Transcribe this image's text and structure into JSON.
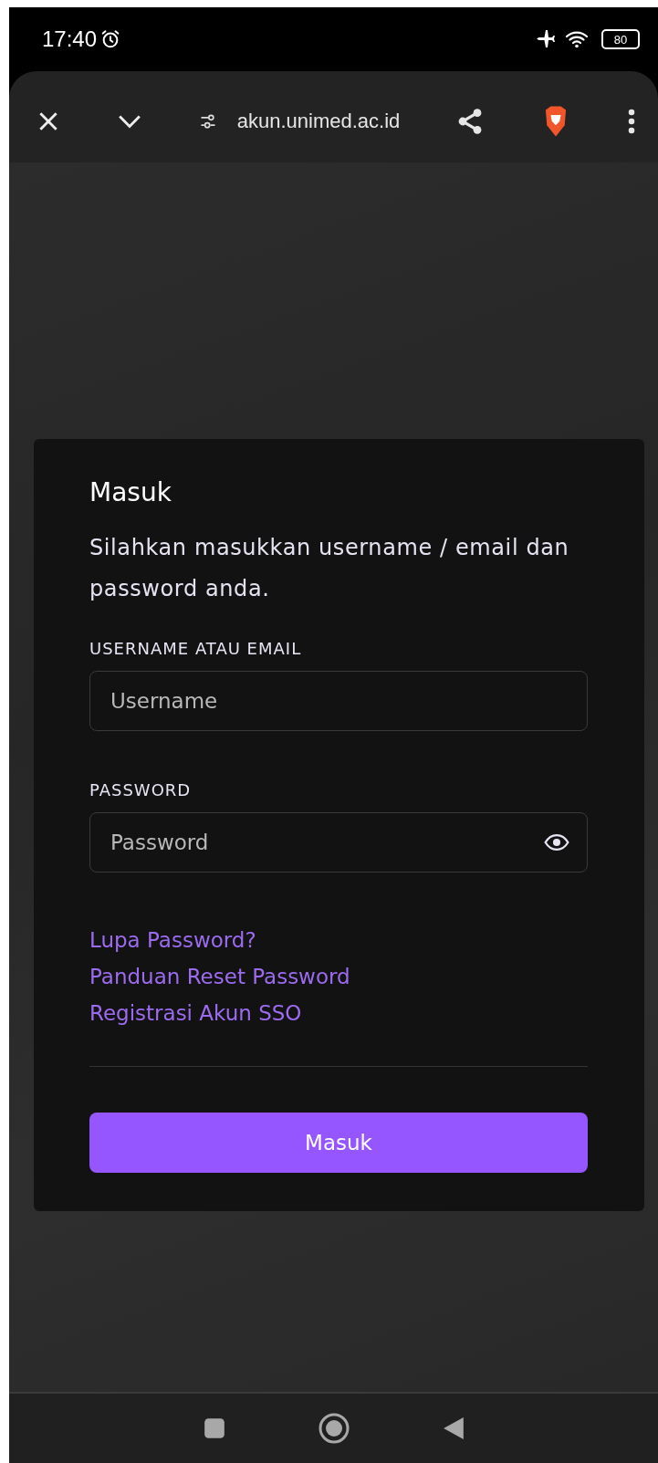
{
  "status_bar": {
    "time": "17:40",
    "battery": "80"
  },
  "browser_toolbar": {
    "url": "akun.unimed.ac.id"
  },
  "login_card": {
    "title": "Masuk",
    "description": "Silahkan masukkan username / email dan password anda.",
    "fields": [
      {
        "kind": "text",
        "label": "USERNAME ATAU EMAIL",
        "placeholder": "Username"
      },
      {
        "kind": "password",
        "label": "PASSWORD",
        "placeholder": "Password"
      }
    ],
    "links": [
      "Lupa Password?",
      "Panduan Reset Password",
      "Registrasi Akun SSO"
    ],
    "submit": "Masuk"
  }
}
